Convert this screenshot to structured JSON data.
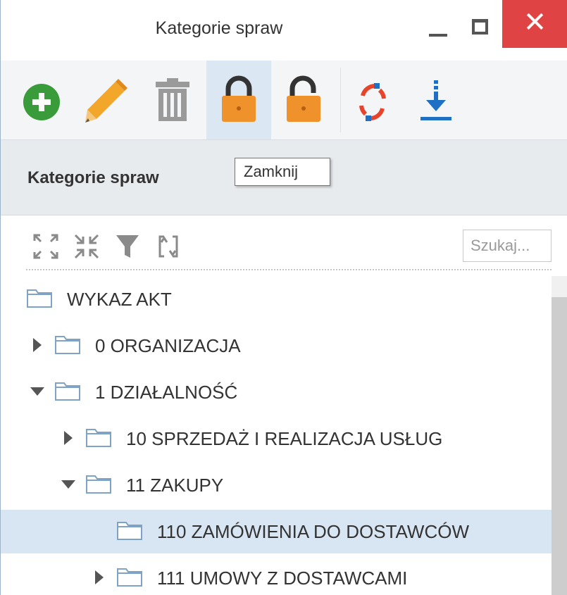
{
  "window": {
    "title": "Kategorie spraw",
    "close_glyph": "✕"
  },
  "toolbar": {
    "buttons": [
      {
        "name": "add",
        "icon": "plus-circle-icon",
        "color": "#3a9b3a"
      },
      {
        "name": "edit",
        "icon": "pencil-icon",
        "color": "#f2a72b"
      },
      {
        "name": "delete",
        "icon": "trash-icon",
        "color": "#9a9a9a"
      },
      {
        "name": "lock",
        "icon": "lock-icon",
        "color": "#f0922b",
        "active": true
      },
      {
        "name": "unlock",
        "icon": "unlock-icon",
        "color": "#f0922b"
      },
      {
        "name": "refresh",
        "icon": "refresh-icon",
        "color": "#e8442c"
      },
      {
        "name": "download",
        "icon": "download-icon",
        "color": "#1f6fc4"
      }
    ],
    "tooltip": "Zamknij"
  },
  "section": {
    "title": "Kategorie spraw"
  },
  "tree_tools": {
    "search_placeholder": "Szukaj...",
    "icons": [
      "expand-all-icon",
      "collapse-all-icon",
      "filter-icon",
      "sync-icon"
    ]
  },
  "tree": {
    "nodes": [
      {
        "label": "WYKAZ AKT",
        "level": 0,
        "arrow": "none",
        "selected": false
      },
      {
        "label": "0 ORGANIZACJA",
        "level": 1,
        "arrow": "collapsed",
        "selected": false
      },
      {
        "label": "1 DZIAŁALNOŚĆ",
        "level": 1,
        "arrow": "expanded",
        "selected": false
      },
      {
        "label": "10 SPRZEDAŻ I REALIZACJA USŁUG",
        "level": 2,
        "arrow": "collapsed",
        "selected": false
      },
      {
        "label": "11 ZAKUPY",
        "level": 2,
        "arrow": "expanded",
        "selected": false
      },
      {
        "label": "110 ZAMÓWIENIA DO DOSTAWCÓW",
        "level": 3,
        "arrow": "none",
        "selected": true
      },
      {
        "label": "111 UMOWY Z DOSTAWCAMI",
        "level": 3,
        "arrow": "collapsed",
        "selected": false
      }
    ]
  }
}
